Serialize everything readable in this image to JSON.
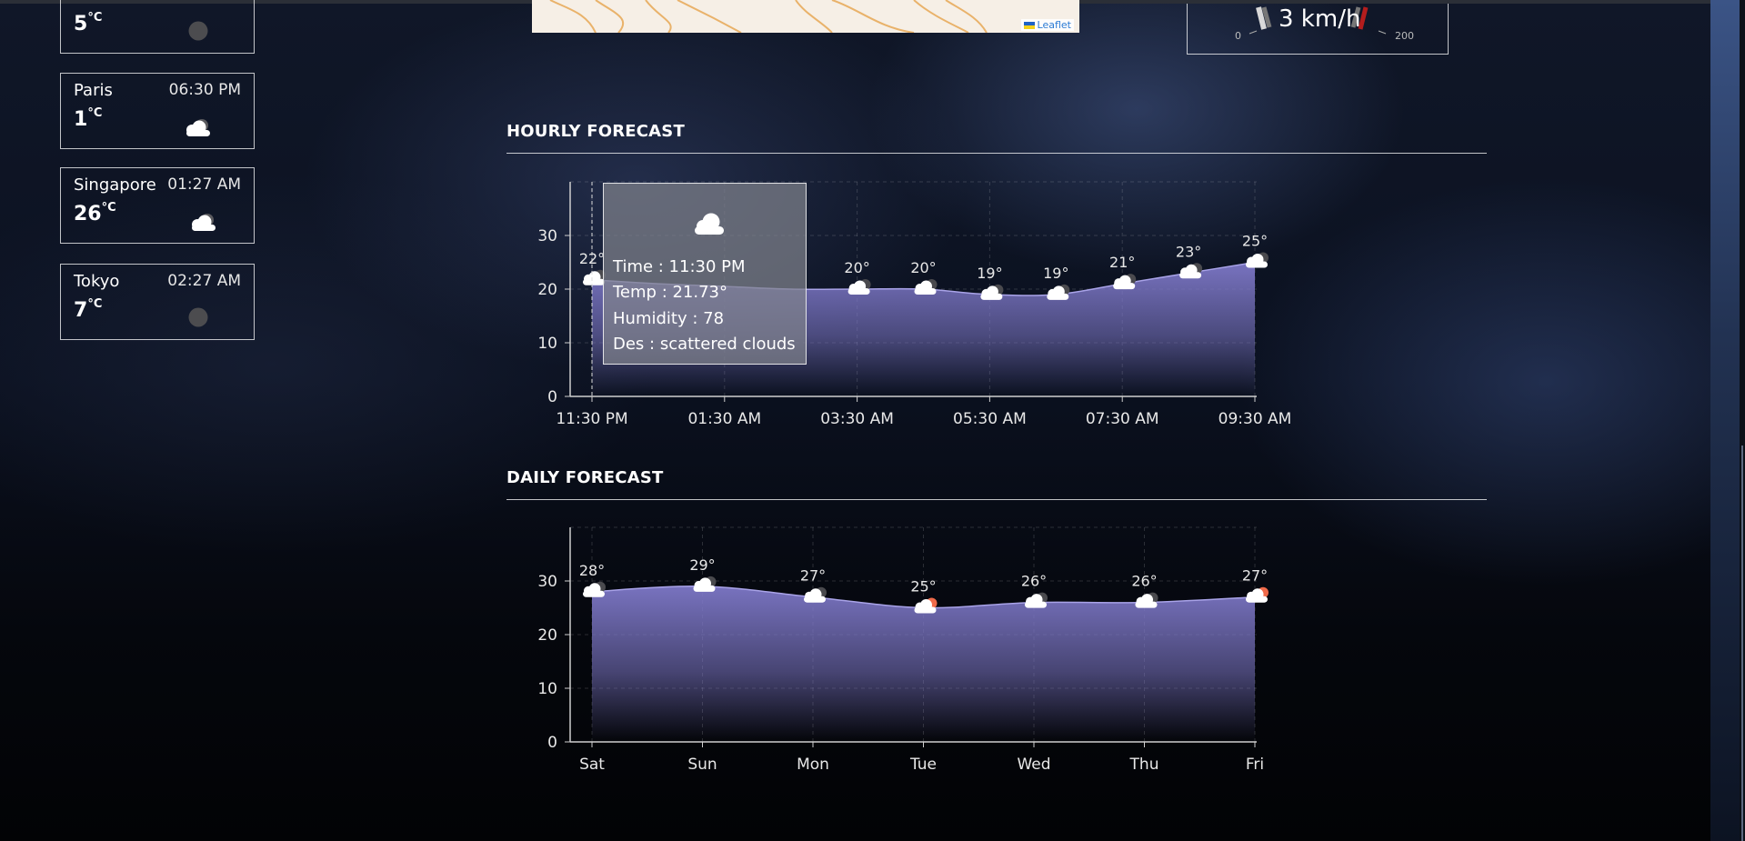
{
  "cities": [
    {
      "name": "",
      "time": "",
      "temp": "5",
      "unit": "°C",
      "icon": "clear-night-icon"
    },
    {
      "name": "Paris",
      "time": "06:30 PM",
      "temp": "1",
      "unit": "°C",
      "icon": "cloud-icon"
    },
    {
      "name": "Singapore",
      "time": "01:27 AM",
      "temp": "26",
      "unit": "°C",
      "icon": "cloud-icon"
    },
    {
      "name": "Tokyo",
      "time": "02:27 AM",
      "temp": "7",
      "unit": "°C",
      "icon": "clear-night-icon"
    }
  ],
  "map": {
    "attribution": "Leaflet"
  },
  "wind_gauge": {
    "speed": "3 km/h",
    "min": "0",
    "max": "200"
  },
  "hourly": {
    "title": "HOURLY FORECAST"
  },
  "daily": {
    "title": "DAILY FORECAST"
  },
  "tooltip": {
    "icon": "cloud-icon",
    "time": "Time : 11:30 PM",
    "temp": "Temp : 21.73°",
    "humidity": "Humidity : 78",
    "description": "Des : scattered clouds"
  },
  "chart_data": [
    {
      "type": "area",
      "name": "hourly",
      "x": [
        "11:30 PM",
        "12:30 AM",
        "01:30 AM",
        "02:30 AM",
        "03:30 AM",
        "04:30 AM",
        "05:30 AM",
        "06:30 AM",
        "07:30 AM",
        "08:30 AM",
        "09:30 AM"
      ],
      "tick_labels": [
        "11:30 PM",
        "01:30 AM",
        "03:30 AM",
        "05:30 AM",
        "07:30 AM",
        "09:30 AM"
      ],
      "values": [
        21.73,
        21,
        20.5,
        20,
        20,
        20,
        19,
        19,
        21,
        23,
        25
      ],
      "data_labels": [
        "22°",
        "",
        "",
        "",
        "20°",
        "20°",
        "19°",
        "19°",
        "21°",
        "23°",
        "25°"
      ],
      "yticks": [
        0,
        10,
        20,
        30
      ],
      "ylim": [
        0,
        40
      ],
      "grid": true,
      "fill_color": "#7e78c8"
    },
    {
      "type": "area",
      "name": "daily",
      "x": [
        "Sat",
        "Sun",
        "Mon",
        "Tue",
        "Wed",
        "Thu",
        "Fri"
      ],
      "values": [
        28,
        29,
        27,
        25,
        26,
        26,
        27
      ],
      "data_labels": [
        "28°",
        "29°",
        "27°",
        "25°",
        "26°",
        "26°",
        "27°"
      ],
      "icons": [
        "cloud-icon",
        "cloud-icon",
        "cloud-icon",
        "cloud-sun-icon",
        "cloud-icon",
        "cloud-icon",
        "cloud-sun-icon"
      ],
      "yticks": [
        0,
        10,
        20,
        30
      ],
      "ylim": [
        0,
        40
      ],
      "grid": true,
      "fill_color": "#7e78c8"
    }
  ]
}
